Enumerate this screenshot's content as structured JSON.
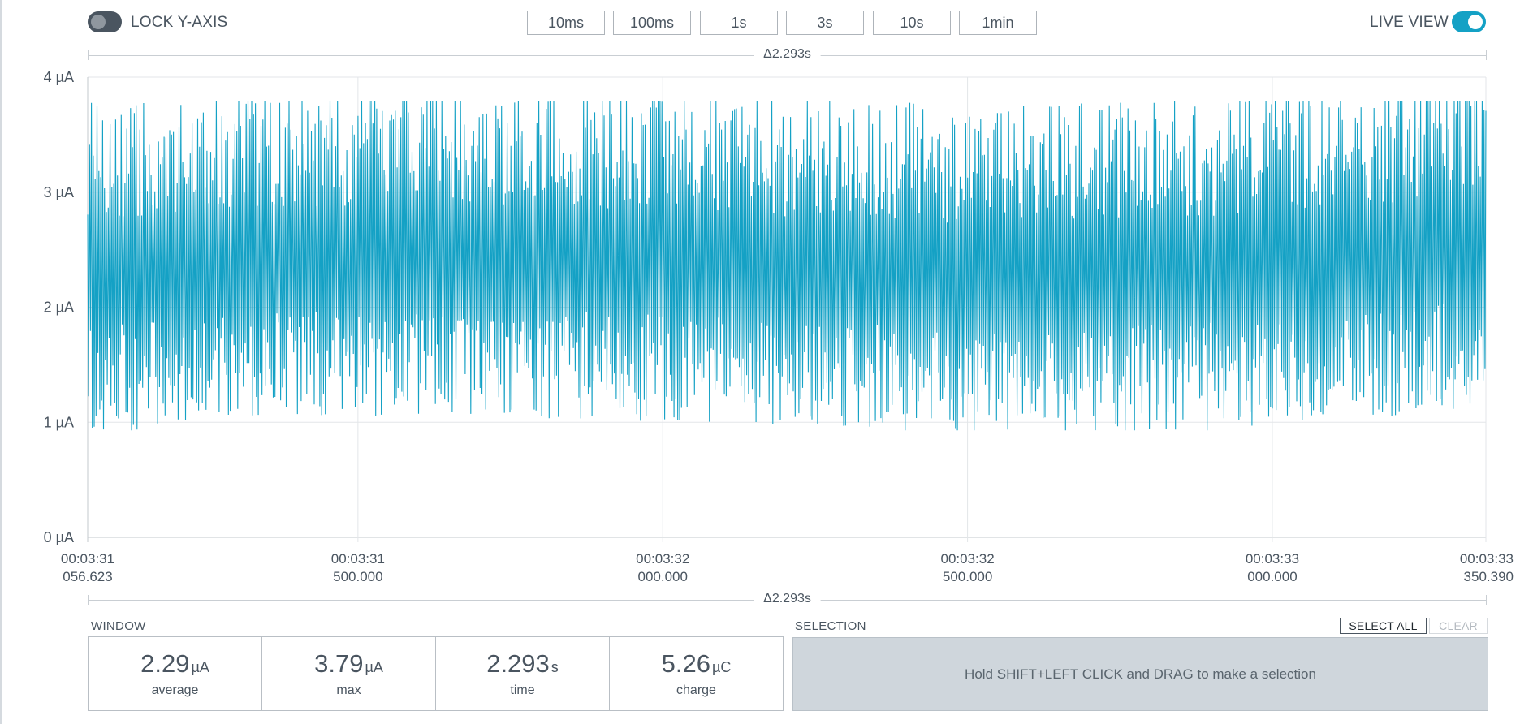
{
  "toolbar": {
    "lock_y_axis": {
      "label": "LOCK Y-AXIS",
      "enabled": false
    },
    "live_view": {
      "label": "LIVE VIEW",
      "enabled": true
    },
    "window_buttons": [
      "10ms",
      "100ms",
      "1s",
      "3s",
      "10s",
      "1min"
    ]
  },
  "delta_label": "Δ2.293s",
  "chart_data": {
    "type": "line",
    "series": [
      {
        "color": "#14a1c5",
        "x_start": "00:03:31.056.623",
        "x_end": "00:03:33.350.390",
        "description": "dense current trace oscillating between roughly 1 µA and 3.8 µA",
        "mean": 2.29,
        "max": 3.79,
        "min": 0.93
      }
    ],
    "yticks": [
      "0 µA",
      "1 µA",
      "2 µA",
      "3 µA",
      "4 µA"
    ],
    "ylim": [
      0,
      4
    ],
    "xticks": [
      {
        "time": "00:03:31",
        "ms": "056.623"
      },
      {
        "time": "00:03:31",
        "ms": "500.000"
      },
      {
        "time": "00:03:32",
        "ms": "000.000"
      },
      {
        "time": "00:03:32",
        "ms": "500.000"
      },
      {
        "time": "00:03:33",
        "ms": "000.000"
      },
      {
        "time": "00:03:33",
        "ms": "350.390"
      }
    ],
    "x_tick_values_s": [
      0,
      0.443377,
      0.943377,
      1.443377,
      1.943377,
      2.293767
    ],
    "grid": true
  },
  "window_stats": {
    "title": "WINDOW",
    "items": [
      {
        "value": "2.29",
        "unit": "µA",
        "label": "average"
      },
      {
        "value": "3.79",
        "unit": "µA",
        "label": "max"
      },
      {
        "value": "2.293",
        "unit": "s",
        "label": "time"
      },
      {
        "value": "5.26",
        "unit": "µC",
        "label": "charge"
      }
    ]
  },
  "selection": {
    "title": "SELECTION",
    "select_all": "SELECT ALL",
    "clear": "CLEAR",
    "hint": "Hold SHIFT+LEFT CLICK and DRAG to make a selection"
  }
}
